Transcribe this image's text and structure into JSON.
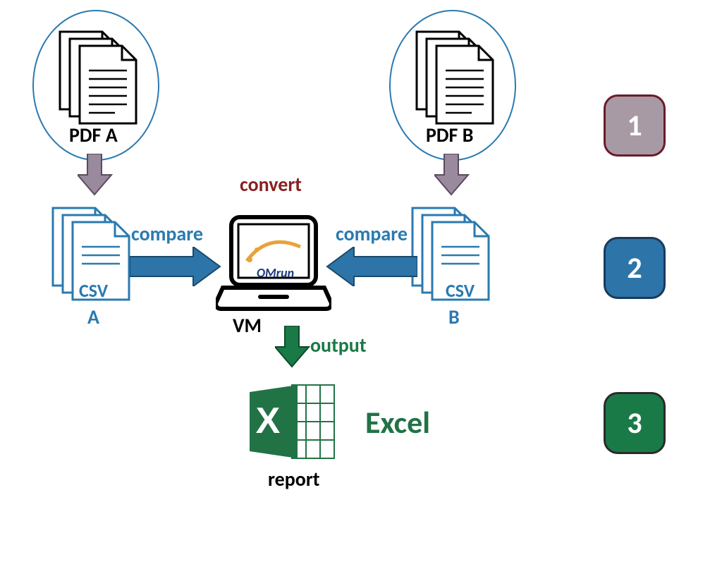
{
  "sources": {
    "a": {
      "label": "PDF A",
      "csv_label": "CSV",
      "csv_letter": "A"
    },
    "b": {
      "label": "PDF B",
      "csv_label": "CSV",
      "csv_letter": "B"
    }
  },
  "actions": {
    "convert": "convert",
    "compare_left": "compare",
    "compare_right": "compare",
    "output": "output"
  },
  "center": {
    "tool_label": "OMrun",
    "vm_label": "VM"
  },
  "result": {
    "app_label": "Excel",
    "caption": "report"
  },
  "steps": {
    "one": "1",
    "two": "2",
    "three": "3"
  },
  "colors": {
    "blue": "#2a7ab0",
    "dark_red": "#8a1f1f",
    "purple_gray": "#9a8a9e",
    "teal_blue": "#2d74a8",
    "green": "#1a7a47",
    "excel_green": "#217346",
    "step1_bg": "#a89aa4",
    "step1_border": "#6b1b29",
    "step2_bg": "#2d74a8",
    "step2_border": "#1a3a5c",
    "step3_bg": "#1a7a47",
    "step3_border": "#2b2b2b"
  }
}
